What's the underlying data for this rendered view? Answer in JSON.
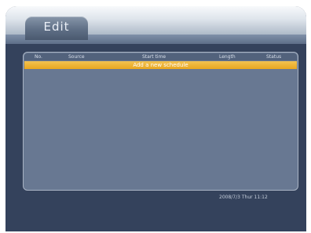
{
  "tabs": {
    "active_label": "Edit"
  },
  "table": {
    "columns": [
      "No.",
      "Source",
      "Start time",
      "Length",
      "Status"
    ],
    "rows": [
      {
        "label": "Add a new schedule",
        "selected": true
      }
    ]
  },
  "status": {
    "datetime": "2008/7/3 Thur 11:12"
  },
  "colors": {
    "background": "#34425c",
    "panel": "#687892",
    "highlight": "#e9a721"
  }
}
